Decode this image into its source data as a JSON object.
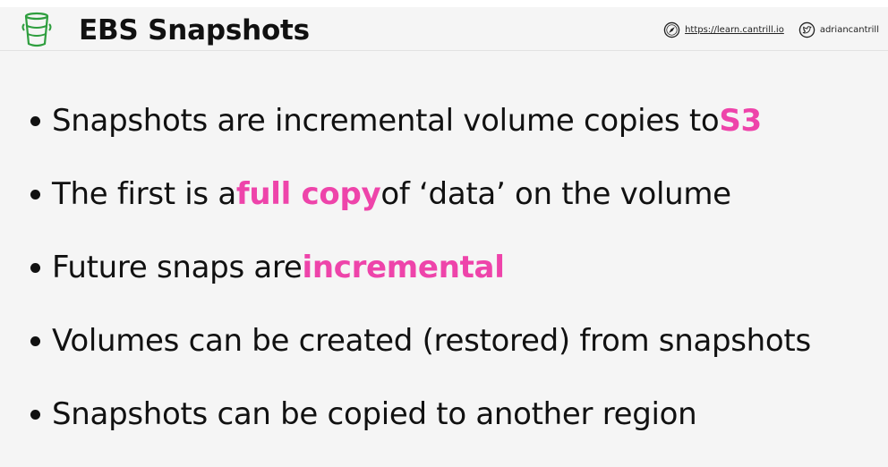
{
  "header": {
    "title": "EBS Snapshots",
    "logo_icon": "bucket-icon",
    "website_icon": "compass-icon",
    "website_label": "https://learn.cantrill.io",
    "twitter_icon": "twitter-bird-icon",
    "twitter_label": "adriancantrill"
  },
  "colors": {
    "highlight": "#ee44aa",
    "logo": "#2e9e3e",
    "background": "#f5f5f5",
    "text": "#111111"
  },
  "bullets": [
    {
      "before": "Snapshots are incremental volume copies to ",
      "highlight": "S3",
      "after": ""
    },
    {
      "before": "The first is a ",
      "highlight": "full copy",
      "after": " of ‘data’ on the volume"
    },
    {
      "before": "Future snaps are ",
      "highlight": "incremental",
      "after": ""
    },
    {
      "before": "Volumes can be created (restored) from snapshots",
      "highlight": "",
      "after": ""
    },
    {
      "before": "Snapshots can be copied to another region",
      "highlight": "",
      "after": ""
    }
  ]
}
